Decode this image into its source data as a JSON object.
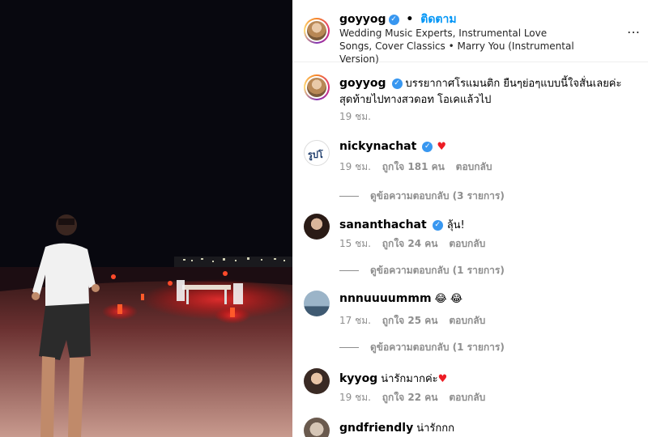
{
  "post": {
    "author": "goyyog",
    "follow_label": "ติดตาม",
    "separator": "•",
    "music": "Wedding Music Experts, Instrumental Love Songs, Cover Classics • Marry You (Instrumental Version)",
    "more_label": "…"
  },
  "caption": {
    "author": "goyyog",
    "text": "บรรยากาศโรแมนติก ยืนๆย่อๆแบบนี้ใจสั่นเลยค่ะ สุดท้ายไปทางสวดอท โอเคแล้วไป",
    "time": "19 ชม."
  },
  "comments": [
    {
      "user": "nickynachat",
      "verified": true,
      "text": "♥",
      "time": "19 ชม.",
      "likes": "ถูกใจ 181 คน",
      "reply": "ตอบกลับ",
      "view_replies": "ดูข้อความตอบกลับ (3 รายการ)",
      "avatar_text": "รูปโ"
    },
    {
      "user": "sananthachat",
      "verified": true,
      "text": "ลุ้น!",
      "time": "15 ชม.",
      "likes": "ถูกใจ 24 คน",
      "reply": "ตอบกลับ",
      "view_replies": "ดูข้อความตอบกลับ (1 รายการ)"
    },
    {
      "user": "nnnuuuummm",
      "verified": false,
      "text": "😂 😂",
      "time": "17 ชม.",
      "likes": "ถูกใจ 25 คน",
      "reply": "ตอบกลับ",
      "view_replies": "ดูข้อความตอบกลับ (1 รายการ)"
    },
    {
      "user": "kyyog",
      "verified": false,
      "text": "น่ารักมากค่ะ",
      "heart": "♥",
      "time": "19 ชม.",
      "likes": "ถูกใจ 22 คน",
      "reply": "ตอบกลับ"
    },
    {
      "user": "gndfriendly",
      "verified": false,
      "text": "น่ารักกก"
    }
  ],
  "verified_glyph": "✓",
  "colors": {
    "link": "#0095f6",
    "muted": "#8e8e8e",
    "verified": "#3897f0",
    "heart": "#ed1c24"
  },
  "icons": [
    "verified-badge-icon",
    "more-options-icon",
    "heart-icon"
  ]
}
